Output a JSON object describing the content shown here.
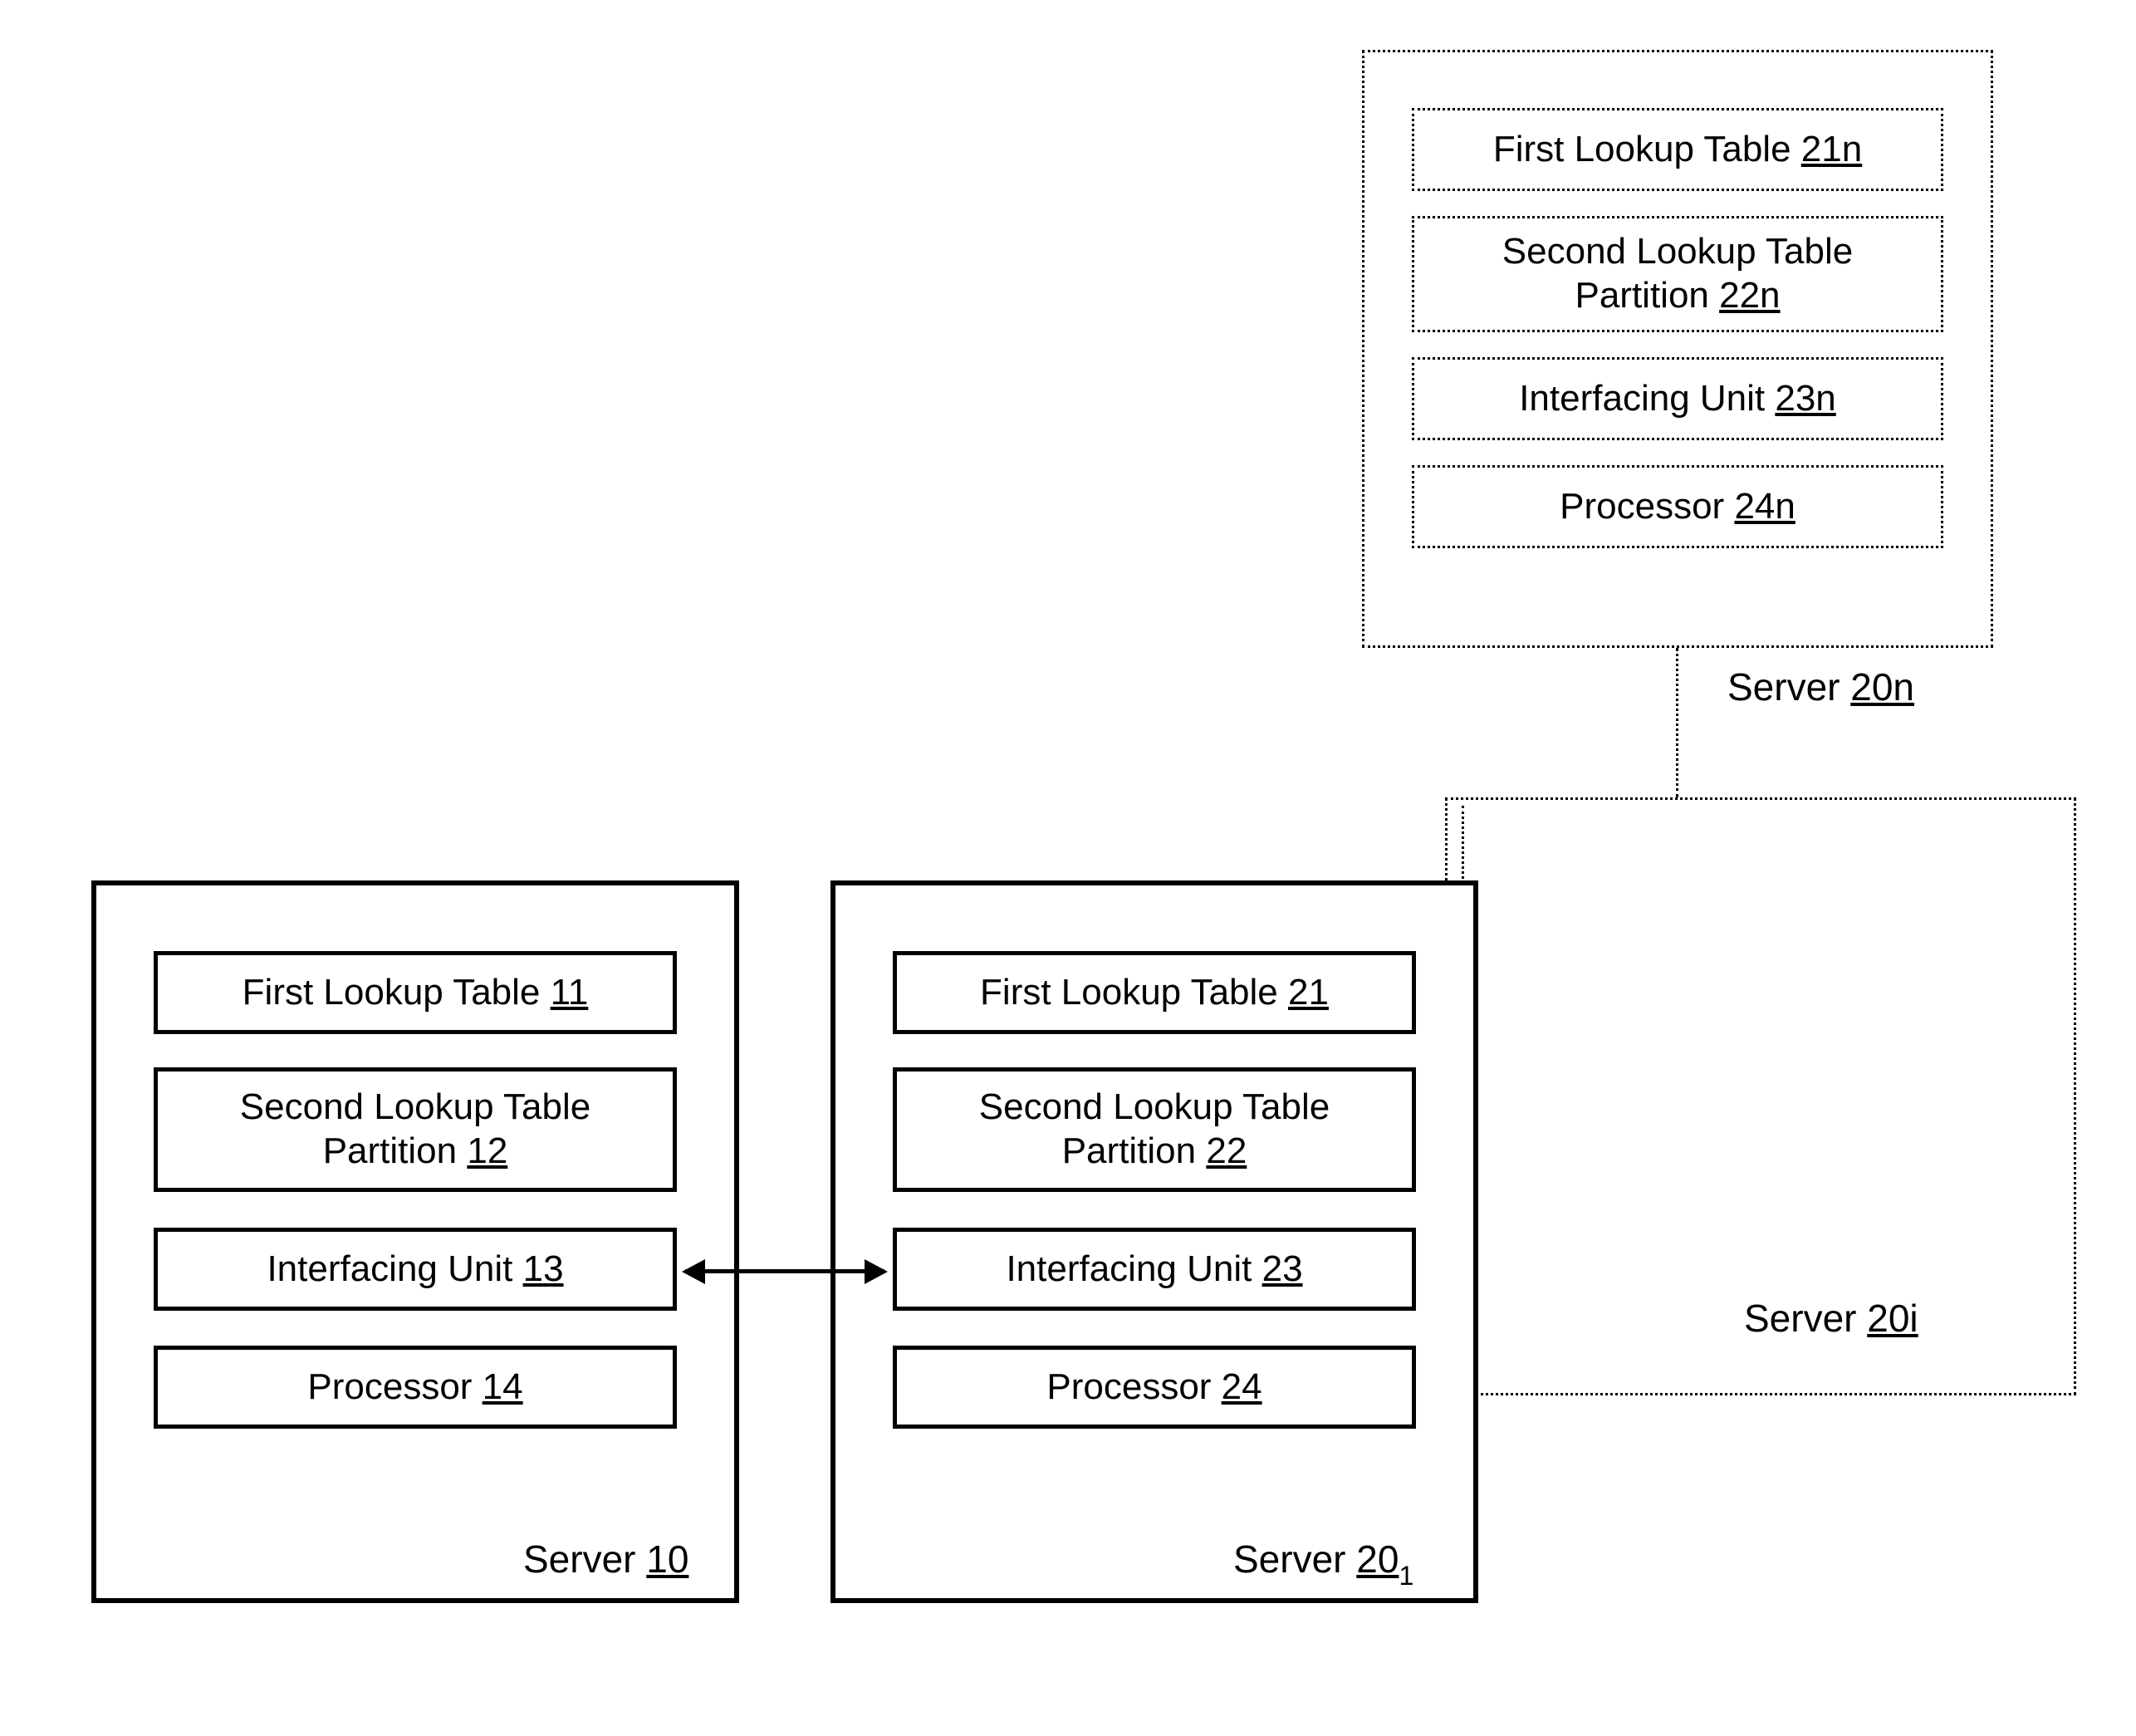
{
  "server10": {
    "label_prefix": "Server ",
    "label_ref": "10",
    "first_lookup": {
      "text": "First Lookup Table ",
      "ref": "11"
    },
    "second_lookup": {
      "line1": "Second Lookup Table",
      "line2_prefix": "Partition ",
      "ref": "12"
    },
    "interfacing": {
      "text": "Interfacing Unit ",
      "ref": "13"
    },
    "processor": {
      "text": "Processor ",
      "ref": "14"
    }
  },
  "server201": {
    "label_prefix": "Server ",
    "label_ref": "20",
    "label_sub": "1",
    "first_lookup": {
      "text": "First Lookup Table ",
      "ref": "21"
    },
    "second_lookup": {
      "line1": "Second Lookup Table",
      "line2_prefix": "Partition ",
      "ref": "22"
    },
    "interfacing": {
      "text": "Interfacing Unit ",
      "ref": "23"
    },
    "processor": {
      "text": "Processor ",
      "ref": "24"
    }
  },
  "server20i": {
    "label_prefix": "Server ",
    "label_ref": "20i"
  },
  "server20n": {
    "label_prefix": "Server ",
    "label_ref": "20n",
    "first_lookup": {
      "text": "First Lookup Table ",
      "ref": "21n"
    },
    "second_lookup": {
      "line1": "Second Lookup Table",
      "line2_prefix": "Partition ",
      "ref": "22n"
    },
    "interfacing": {
      "text": "Interfacing Unit ",
      "ref": "23n"
    },
    "processor": {
      "text": "Processor ",
      "ref": "24n"
    }
  }
}
